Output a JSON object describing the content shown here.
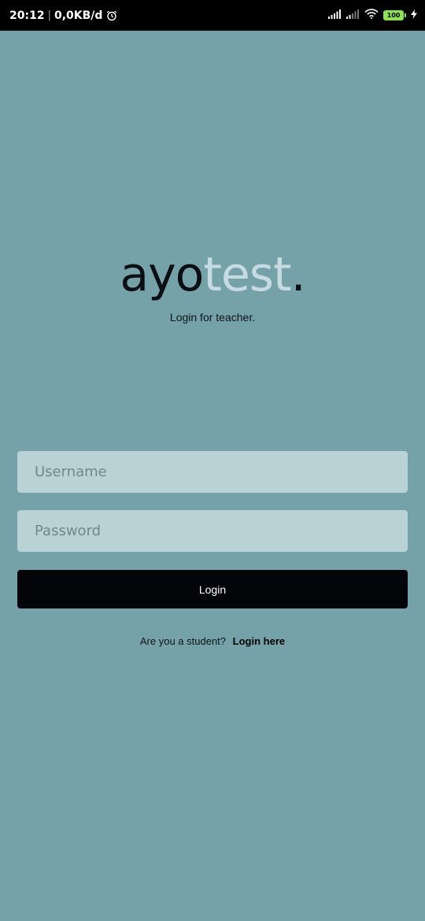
{
  "status_bar": {
    "time": "20:12",
    "separator": "|",
    "network_speed": "0,0KB/d",
    "battery_level": "100",
    "icons": [
      "alarm-icon",
      "signal-icon",
      "signal-weak-icon",
      "wifi-icon",
      "battery-icon",
      "charging-icon"
    ]
  },
  "logo": {
    "part1": "ayo",
    "part2": "test",
    "dot": "."
  },
  "subtitle": "Login for teacher.",
  "form": {
    "username_placeholder": "Username",
    "password_placeholder": "Password",
    "login_label": "Login"
  },
  "footer": {
    "question": "Are you a student?",
    "link_label": "Login here"
  },
  "colors": {
    "background": "#75a2a8",
    "input_background": "#b9d2d5",
    "button_background": "#040508",
    "logo_dark": "#0b0e12",
    "logo_light": "#c6dbe1"
  }
}
